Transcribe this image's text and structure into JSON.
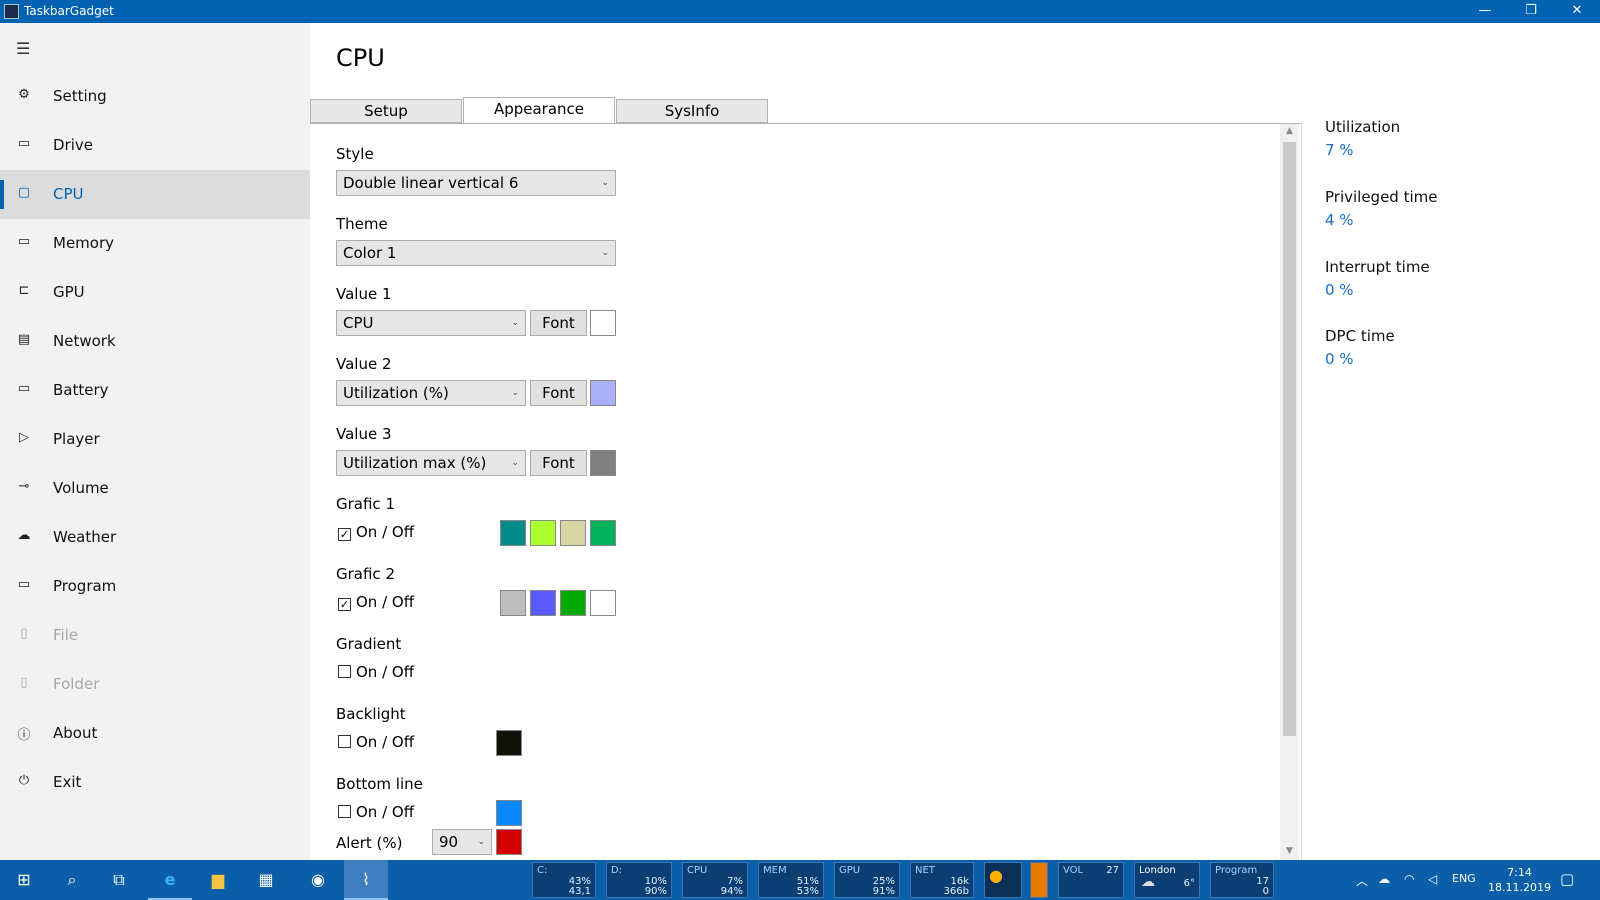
{
  "window": {
    "title": "TaskbarGadget",
    "min": "—",
    "max": "❐",
    "close": "✕"
  },
  "sidebar": {
    "menu_icon": "hamburger-icon",
    "items": [
      {
        "label": "Setting",
        "icon": "gear-icon",
        "glyph": "⚙"
      },
      {
        "label": "Drive",
        "icon": "drive-icon",
        "glyph": "▭"
      },
      {
        "label": "CPU",
        "icon": "cpu-icon",
        "glyph": "▢"
      },
      {
        "label": "Memory",
        "icon": "memory-icon",
        "glyph": "▭"
      },
      {
        "label": "GPU",
        "icon": "gpu-icon",
        "glyph": "⊏"
      },
      {
        "label": "Network",
        "icon": "network-icon",
        "glyph": "▤"
      },
      {
        "label": "Battery",
        "icon": "battery-icon",
        "glyph": "▭"
      },
      {
        "label": "Player",
        "icon": "player-icon",
        "glyph": "▷"
      },
      {
        "label": "Volume",
        "icon": "volume-icon",
        "glyph": "⊸"
      },
      {
        "label": "Weather",
        "icon": "weather-icon",
        "glyph": "☁"
      },
      {
        "label": "Program",
        "icon": "program-icon",
        "glyph": "▭"
      },
      {
        "label": "File",
        "icon": "file-icon",
        "glyph": "▯"
      },
      {
        "label": "Folder",
        "icon": "folder-icon",
        "glyph": "▯"
      },
      {
        "label": "About",
        "icon": "info-icon",
        "glyph": "ⓘ"
      },
      {
        "label": "Exit",
        "icon": "power-icon",
        "glyph": "⏻"
      }
    ],
    "active": "CPU",
    "disabled": [
      "File",
      "Folder"
    ]
  },
  "page": {
    "title": "CPU"
  },
  "tabs": [
    {
      "label": "Setup"
    },
    {
      "label": "Appearance"
    },
    {
      "label": "SysInfo"
    }
  ],
  "selected_tab": "Appearance",
  "form": {
    "style": {
      "label": "Style",
      "value": "Double linear vertical 6"
    },
    "theme": {
      "label": "Theme",
      "value": "Color 1"
    },
    "value1": {
      "label": "Value 1",
      "value": "CPU",
      "font": "Font",
      "color": "#ffffff"
    },
    "value2": {
      "label": "Value 2",
      "value": "Utilization (%)",
      "font": "Font",
      "color": "#aab0f8"
    },
    "value3": {
      "label": "Value 3",
      "value": "Utilization max (%)",
      "font": "Font",
      "color": "#808080"
    },
    "grafic1": {
      "label": "Grafic 1",
      "check": "On / Off",
      "checked": true,
      "colors": [
        "#008b8b",
        "#adff2f",
        "#d6d6a6",
        "#00b25a"
      ]
    },
    "grafic2": {
      "label": "Grafic 2",
      "check": "On / Off",
      "checked": true,
      "colors": [
        "#bdbdbd",
        "#5a5aff",
        "#00aa00",
        "#ffffff"
      ]
    },
    "gradient": {
      "label": "Gradient",
      "check": "On / Off",
      "checked": false
    },
    "backlight": {
      "label": "Backlight",
      "check": "On / Off",
      "checked": false,
      "color": "#10120a"
    },
    "bottomline": {
      "label": "Bottom line",
      "check": "On / Off",
      "checked": false,
      "color": "#0a86ff"
    },
    "alert": {
      "label": "Alert (%)",
      "value": "90",
      "color": "#d40000"
    }
  },
  "sysinfo": [
    {
      "label": "Utilization",
      "value": "7 %"
    },
    {
      "label": "Privileged time",
      "value": "4 %"
    },
    {
      "label": "Interrupt time",
      "value": "0 %"
    },
    {
      "label": "DPC time",
      "value": "0 %"
    }
  ],
  "taskbar": {
    "gadgets": [
      {
        "title": "C:",
        "v1": "43%",
        "v2": "43,1"
      },
      {
        "title": "D:",
        "v1": "10%",
        "v2": "90%"
      },
      {
        "title": "CPU",
        "v1": "7%",
        "v2": "94%"
      },
      {
        "title": "MEM",
        "v1": "51%",
        "v2": "53%"
      },
      {
        "title": "GPU",
        "v1": "25%",
        "v2": "91%"
      },
      {
        "title": "NET",
        "v1": "16k",
        "v2": "366b"
      },
      {
        "title": "VOL",
        "v1": "27",
        "v2": ""
      },
      {
        "title": "London",
        "v1": "6°",
        "v2": ""
      },
      {
        "title": "Program",
        "v1": "17",
        "v2": "0"
      }
    ],
    "lang": "ENG",
    "time": "7:14",
    "date": "18.11.2019"
  },
  "colors": {
    "accent": "#0063b1",
    "taskbar": "#0b5ea8"
  }
}
